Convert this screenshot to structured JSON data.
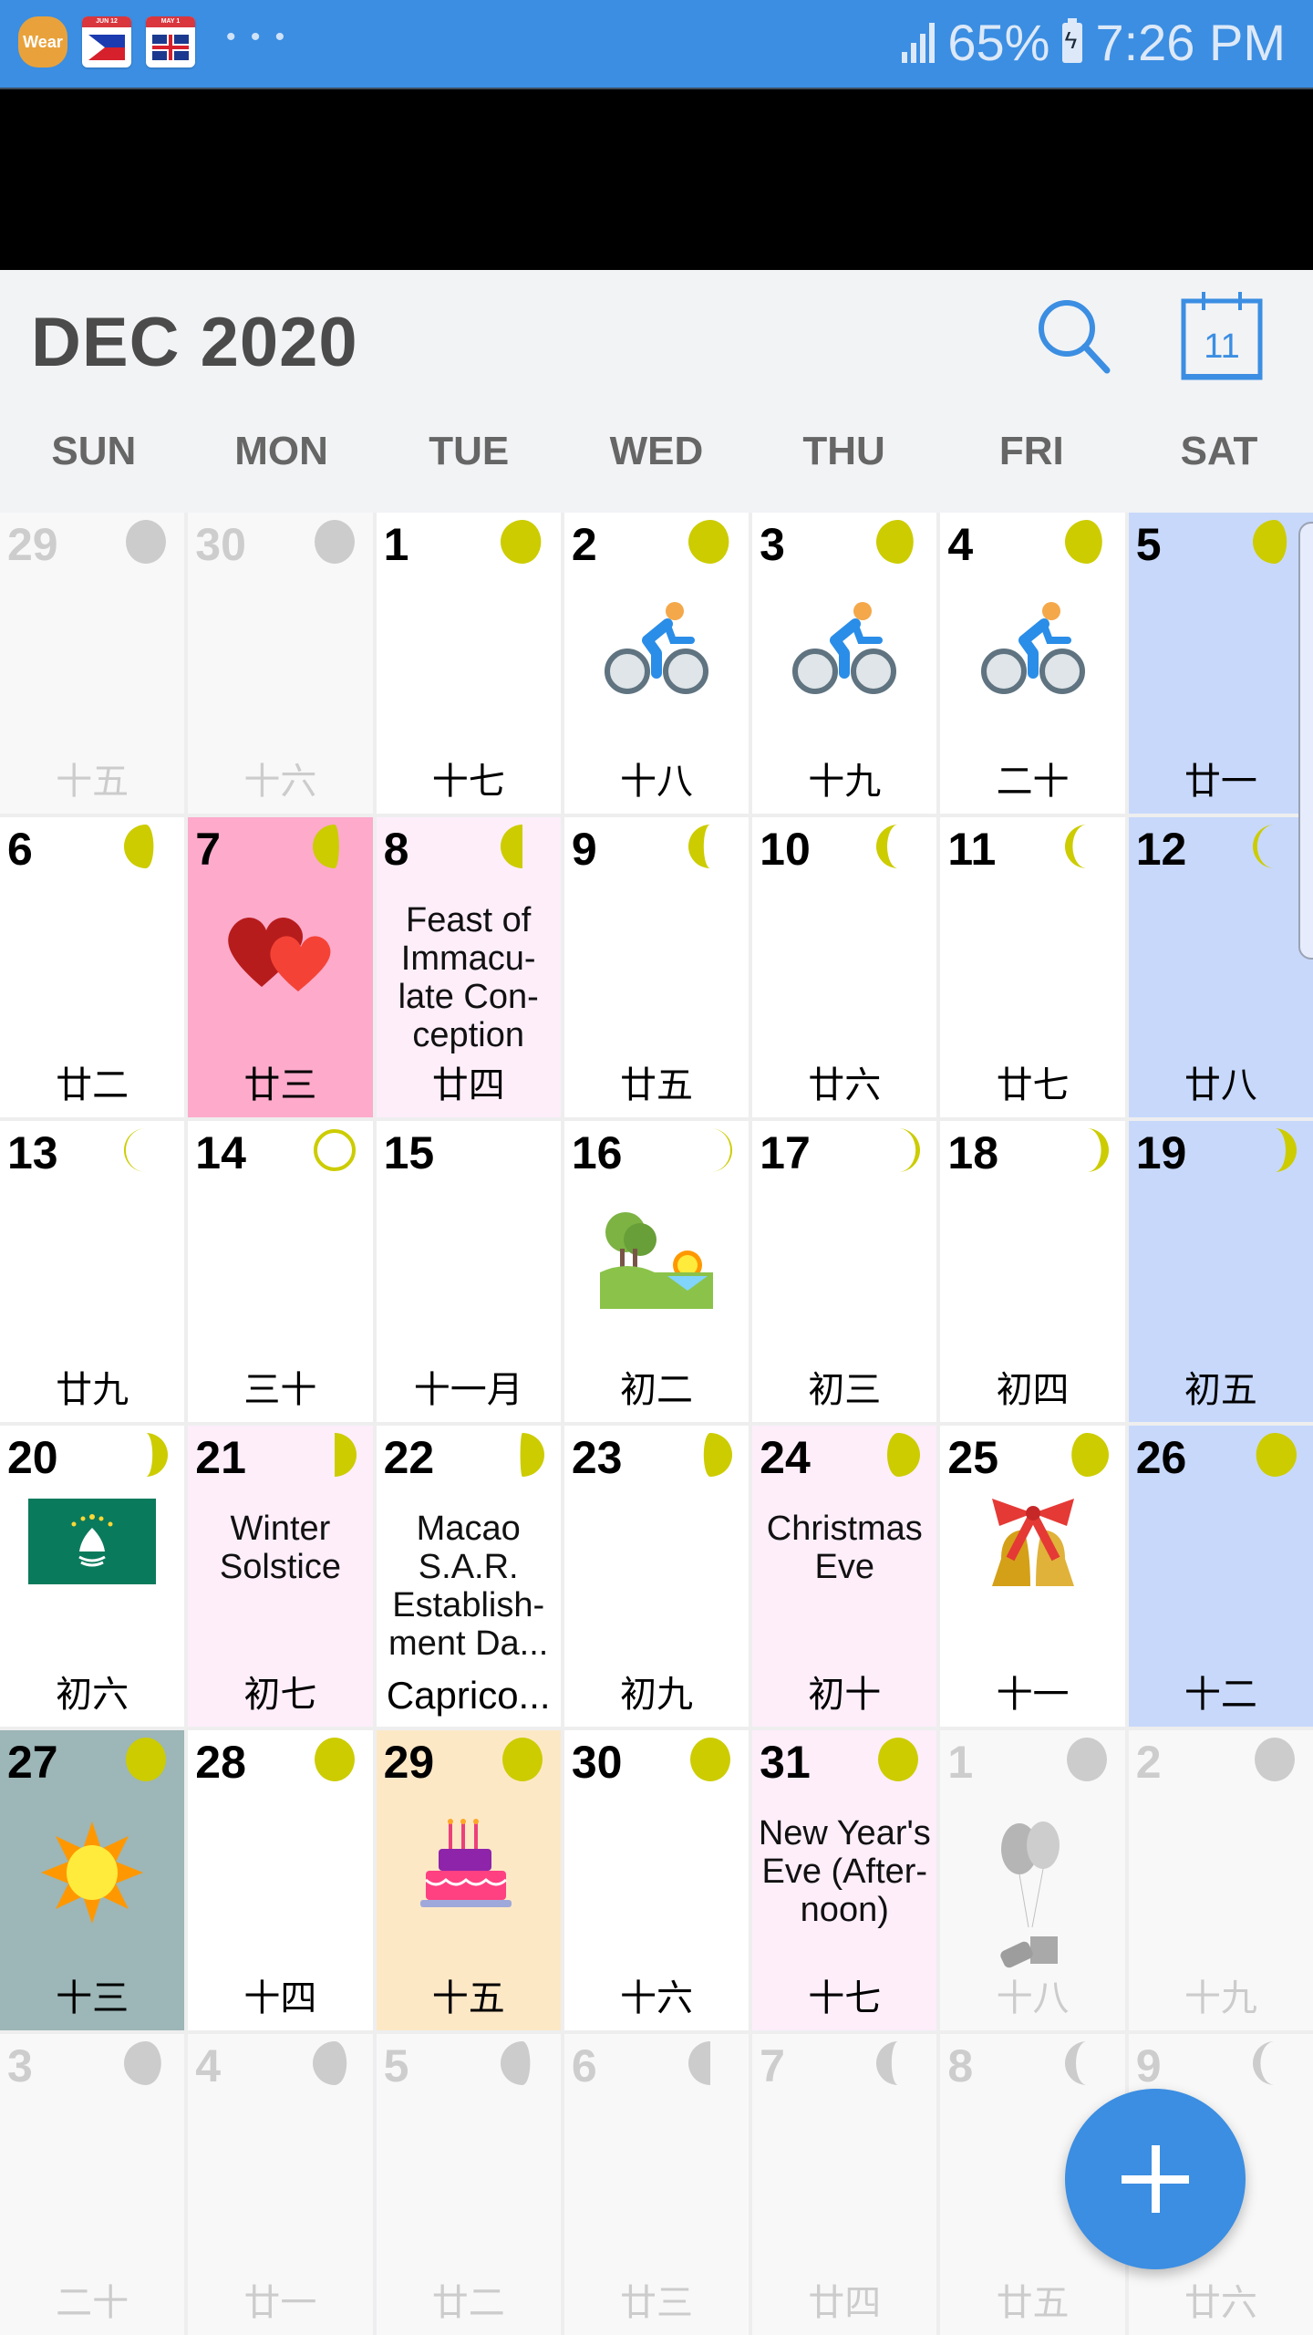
{
  "status_bar": {
    "notification_icons": [
      "wear-app-icon",
      "philippines-flag-calendar-icon",
      "uk-flag-calendar-icon"
    ],
    "wear_label": "Wear",
    "ph_cal_label": "JUN 12",
    "uk_cal_label": "MAY 1",
    "more": "• • •",
    "battery": "65%",
    "time": "7:26 PM"
  },
  "header": {
    "title": "DEC 2020",
    "today_icon_day": "11"
  },
  "weekdays": [
    "SUN",
    "MON",
    "TUE",
    "WED",
    "THU",
    "FRI",
    "SAT"
  ],
  "colors": {
    "accent": "#3b8ee2",
    "moon": "#cccc00",
    "moon_other": "#cccccc",
    "saturday": "#c8d8fb"
  },
  "days": [
    {
      "day": "29",
      "lunar": "十五",
      "other": true,
      "moon": "full"
    },
    {
      "day": "30",
      "lunar": "十六",
      "other": true,
      "moon": "full"
    },
    {
      "day": "1",
      "lunar": "十七",
      "moon": "waning-gibbous-1"
    },
    {
      "day": "2",
      "lunar": "十八",
      "moon": "waning-gibbous-1",
      "icon": "cycling-icon"
    },
    {
      "day": "3",
      "lunar": "十九",
      "moon": "waning-gibbous-2",
      "icon": "cycling-icon"
    },
    {
      "day": "4",
      "lunar": "二十",
      "moon": "waning-gibbous-2",
      "icon": "cycling-icon"
    },
    {
      "day": "5",
      "lunar": "廿一",
      "moon": "waning-gibbous-3",
      "sat": true
    },
    {
      "day": "6",
      "lunar": "廿二",
      "moon": "waning-gibbous-4"
    },
    {
      "day": "7",
      "lunar": "廿三",
      "moon": "last-quarter-0",
      "bg": "hot-pink",
      "icon": "hearts-icon"
    },
    {
      "day": "8",
      "lunar": "廿四",
      "moon": "last-quarter",
      "bg": "event-pink",
      "event": "Feast of Immacu-late Con-ception"
    },
    {
      "day": "9",
      "lunar": "廿五",
      "moon": "waning-crescent-1"
    },
    {
      "day": "10",
      "lunar": "廿六",
      "moon": "waning-crescent-2"
    },
    {
      "day": "11",
      "lunar": "廿七",
      "moon": "waning-crescent-3"
    },
    {
      "day": "12",
      "lunar": "廿八",
      "moon": "waning-crescent-4",
      "sat": true
    },
    {
      "day": "13",
      "lunar": "廿九",
      "moon": "waning-crescent-5"
    },
    {
      "day": "14",
      "lunar": "三十",
      "moon": "new"
    },
    {
      "day": "15",
      "lunar": "十一月",
      "moon": "none"
    },
    {
      "day": "16",
      "lunar": "初二",
      "moon": "waxing-crescent-1",
      "icon": "park-sunrise-icon"
    },
    {
      "day": "17",
      "lunar": "初三",
      "moon": "waxing-crescent-2"
    },
    {
      "day": "18",
      "lunar": "初四",
      "moon": "waxing-crescent-3"
    },
    {
      "day": "19",
      "lunar": "初五",
      "moon": "waxing-crescent-4",
      "sat": true
    },
    {
      "day": "20",
      "lunar": "初六",
      "moon": "waxing-crescent-5",
      "icon": "macau-flag-icon"
    },
    {
      "day": "21",
      "lunar": "初七",
      "moon": "first-quarter",
      "bg": "event-pink",
      "event": "Winter Solstice"
    },
    {
      "day": "22",
      "lunar": "Caprico...",
      "zodiac": true,
      "moon": "first-quarter-1",
      "event": "Macao S.A.R. Establish-ment Da..."
    },
    {
      "day": "23",
      "lunar": "初九",
      "moon": "waxing-gibbous-1"
    },
    {
      "day": "24",
      "lunar": "初十",
      "moon": "waxing-gibbous-2",
      "bg": "event-pink",
      "event": "Christmas Eve"
    },
    {
      "day": "25",
      "lunar": "十一",
      "moon": "waxing-gibbous-3",
      "icon": "christmas-bells-icon"
    },
    {
      "day": "26",
      "lunar": "十二",
      "moon": "waxing-gibbous-4",
      "sat": true
    },
    {
      "day": "27",
      "lunar": "十三",
      "moon": "full",
      "bg": "slate",
      "icon": "sun-icon"
    },
    {
      "day": "28",
      "lunar": "十四",
      "moon": "full"
    },
    {
      "day": "29",
      "lunar": "十五",
      "moon": "full",
      "bg": "peach",
      "icon": "birthday-cake-icon"
    },
    {
      "day": "30",
      "lunar": "十六",
      "moon": "full"
    },
    {
      "day": "31",
      "lunar": "十七",
      "moon": "full",
      "bg": "event-pink",
      "event": "New Year's Eve (After-noon)"
    },
    {
      "day": "1",
      "lunar": "十八",
      "other": true,
      "moon": "full",
      "icon": "new-year-balloons-icon"
    },
    {
      "day": "2",
      "lunar": "十九",
      "other": true,
      "moon": "full"
    },
    {
      "day": "3",
      "lunar": "二十",
      "other": true,
      "moon": "waning-gibbous-2"
    },
    {
      "day": "4",
      "lunar": "廿一",
      "other": true,
      "moon": "waning-gibbous-3"
    },
    {
      "day": "5",
      "lunar": "廿二",
      "other": true,
      "moon": "waning-gibbous-4"
    },
    {
      "day": "6",
      "lunar": "廿三",
      "other": true,
      "moon": "last-quarter"
    },
    {
      "day": "7",
      "lunar": "廿四",
      "other": true,
      "moon": "waning-crescent-1"
    },
    {
      "day": "8",
      "lunar": "廿五",
      "other": true,
      "moon": "waning-crescent-2"
    },
    {
      "day": "9",
      "lunar": "廿六",
      "other": true,
      "moon": "waning-crescent-3"
    }
  ],
  "fab": {
    "label": "+"
  }
}
